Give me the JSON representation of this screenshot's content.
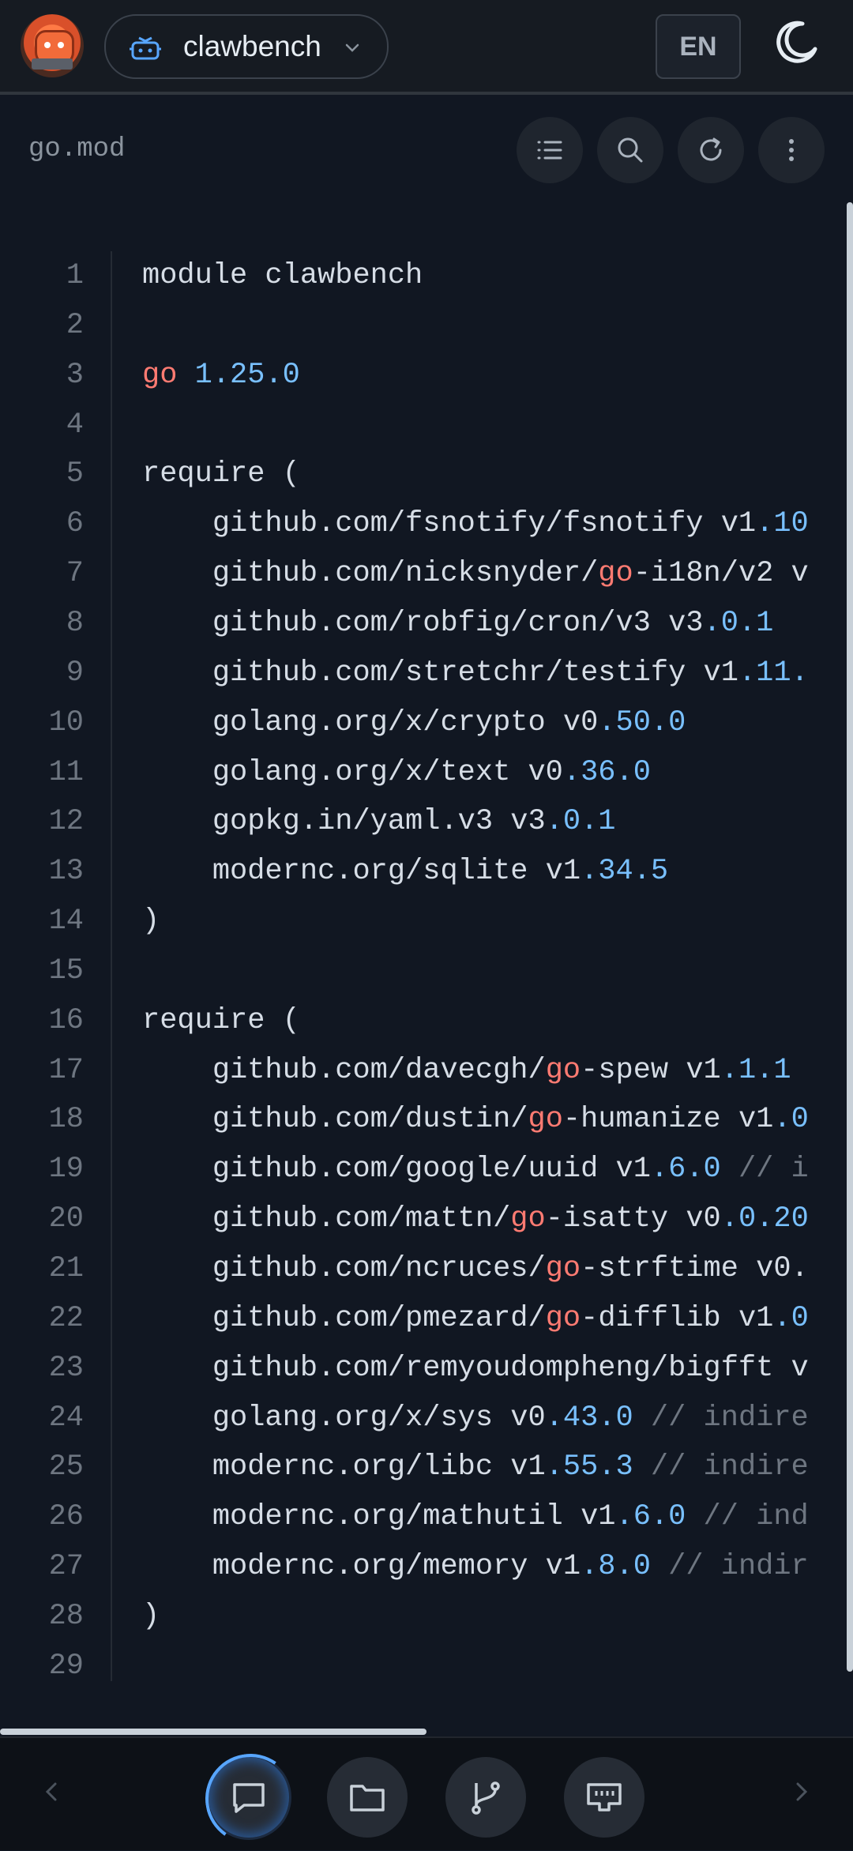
{
  "topbar": {
    "project_name": "clawbench",
    "language": "EN"
  },
  "file": {
    "name": "go.mod"
  },
  "code_lines": [
    {
      "n": "1",
      "parts": [
        [
          "t",
          "module clawbench"
        ]
      ]
    },
    {
      "n": "2",
      "parts": []
    },
    {
      "n": "3",
      "parts": [
        [
          "k",
          "go"
        ],
        [
          "t",
          " "
        ],
        [
          "d",
          "1.25.0"
        ]
      ]
    },
    {
      "n": "4",
      "parts": []
    },
    {
      "n": "5",
      "parts": [
        [
          "t",
          "require ("
        ]
      ]
    },
    {
      "n": "6",
      "parts": [
        [
          "t",
          "    github.com/fsnotify/fsnotify v1"
        ],
        [
          "d",
          ".10"
        ]
      ]
    },
    {
      "n": "7",
      "parts": [
        [
          "t",
          "    github.com/nicksnyder/"
        ],
        [
          "k",
          "go"
        ],
        [
          "t",
          "-i18n/v2 v"
        ]
      ]
    },
    {
      "n": "8",
      "parts": [
        [
          "t",
          "    github.com/robfig/cron/v3 v3"
        ],
        [
          "d",
          ".0.1"
        ]
      ]
    },
    {
      "n": "9",
      "parts": [
        [
          "t",
          "    github.com/stretchr/testify v1"
        ],
        [
          "d",
          ".11."
        ]
      ]
    },
    {
      "n": "10",
      "parts": [
        [
          "t",
          "    golang.org/x/crypto v0"
        ],
        [
          "d",
          ".50.0"
        ]
      ]
    },
    {
      "n": "11",
      "parts": [
        [
          "t",
          "    golang.org/x/text v0"
        ],
        [
          "d",
          ".36.0"
        ]
      ]
    },
    {
      "n": "12",
      "parts": [
        [
          "t",
          "    gopkg.in/yaml.v3 v3"
        ],
        [
          "d",
          ".0.1"
        ]
      ]
    },
    {
      "n": "13",
      "parts": [
        [
          "t",
          "    modernc.org/sqlite v1"
        ],
        [
          "d",
          ".34.5"
        ]
      ]
    },
    {
      "n": "14",
      "parts": [
        [
          "t",
          ")"
        ]
      ]
    },
    {
      "n": "15",
      "parts": []
    },
    {
      "n": "16",
      "parts": [
        [
          "t",
          "require ("
        ]
      ]
    },
    {
      "n": "17",
      "parts": [
        [
          "t",
          "    github.com/davecgh/"
        ],
        [
          "k",
          "go"
        ],
        [
          "t",
          "-spew v1"
        ],
        [
          "d",
          ".1.1"
        ]
      ]
    },
    {
      "n": "18",
      "parts": [
        [
          "t",
          "    github.com/dustin/"
        ],
        [
          "k",
          "go"
        ],
        [
          "t",
          "-humanize v1"
        ],
        [
          "d",
          ".0"
        ]
      ]
    },
    {
      "n": "19",
      "parts": [
        [
          "t",
          "    github.com/google/uuid v1"
        ],
        [
          "d",
          ".6.0"
        ],
        [
          "c",
          " // i"
        ]
      ]
    },
    {
      "n": "20",
      "parts": [
        [
          "t",
          "    github.com/mattn/"
        ],
        [
          "k",
          "go"
        ],
        [
          "t",
          "-isatty v0"
        ],
        [
          "d",
          ".0.20"
        ]
      ]
    },
    {
      "n": "21",
      "parts": [
        [
          "t",
          "    github.com/ncruces/"
        ],
        [
          "k",
          "go"
        ],
        [
          "t",
          "-strftime v0."
        ]
      ]
    },
    {
      "n": "22",
      "parts": [
        [
          "t",
          "    github.com/pmezard/"
        ],
        [
          "k",
          "go"
        ],
        [
          "t",
          "-difflib v1"
        ],
        [
          "d",
          ".0"
        ]
      ]
    },
    {
      "n": "23",
      "parts": [
        [
          "t",
          "    github.com/remyoudompheng/bigfft v"
        ]
      ]
    },
    {
      "n": "24",
      "parts": [
        [
          "t",
          "    golang.org/x/sys v0"
        ],
        [
          "d",
          ".43.0"
        ],
        [
          "c",
          " // indire"
        ]
      ]
    },
    {
      "n": "25",
      "parts": [
        [
          "t",
          "    modernc.org/libc v1"
        ],
        [
          "d",
          ".55.3"
        ],
        [
          "c",
          " // indire"
        ]
      ]
    },
    {
      "n": "26",
      "parts": [
        [
          "t",
          "    modernc.org/mathutil v1"
        ],
        [
          "d",
          ".6.0"
        ],
        [
          "c",
          " // ind"
        ]
      ]
    },
    {
      "n": "27",
      "parts": [
        [
          "t",
          "    modernc.org/memory v1"
        ],
        [
          "d",
          ".8.0"
        ],
        [
          "c",
          " // indir"
        ]
      ]
    },
    {
      "n": "28",
      "parts": [
        [
          "t",
          ")"
        ]
      ]
    },
    {
      "n": "29",
      "parts": []
    }
  ],
  "icons": {
    "avatar": "crab-mascot-avatar",
    "project": "robot-icon",
    "theme": "moon-icon",
    "tools": [
      "list-icon",
      "search-icon",
      "refresh-icon",
      "more-vertical-icon"
    ],
    "nav": [
      "chat-icon",
      "folder-icon",
      "git-branch-icon",
      "terminal-icon"
    ]
  },
  "colors": {
    "background": "#111722",
    "keyword": "#ff7b72",
    "number": "#79c0ff",
    "comment": "#6e7681",
    "accent": "#58a6ff"
  }
}
